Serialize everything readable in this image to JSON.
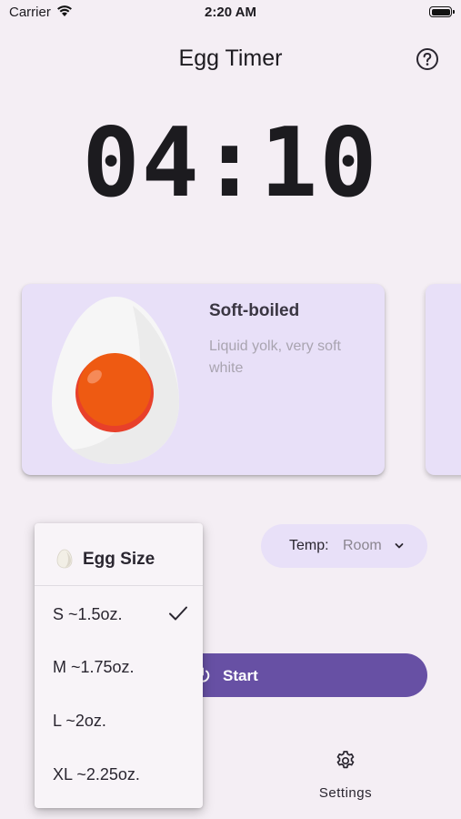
{
  "status_bar": {
    "carrier": "Carrier",
    "time": "2:20 AM"
  },
  "header": {
    "title": "Egg Timer",
    "help_icon": "question-circle-icon"
  },
  "timer": {
    "display": "04:10"
  },
  "egg_card": {
    "title": "Soft-boiled",
    "description": "Liquid yolk, very soft white",
    "image_icon": "soft-boiled-egg-illustration"
  },
  "temperature": {
    "label": "Temp:",
    "value": "Room",
    "icon": "chevron-down-icon"
  },
  "start": {
    "label": "Start",
    "icon": "power-icon"
  },
  "settings": {
    "label": "Settings",
    "icon": "gear-icon"
  },
  "size_menu": {
    "title": "Egg Size",
    "icon": "egg-icon",
    "items": [
      {
        "label": "S ~1.5oz.",
        "selected": true
      },
      {
        "label": "M ~1.75oz.",
        "selected": false
      },
      {
        "label": "L ~2oz.",
        "selected": false
      },
      {
        "label": "XL ~2.25oz.",
        "selected": false
      }
    ]
  },
  "colors": {
    "background": "#f4eef4",
    "card": "#e8e0f8",
    "accent": "#6750a4",
    "yolk": "#ee5a12"
  }
}
